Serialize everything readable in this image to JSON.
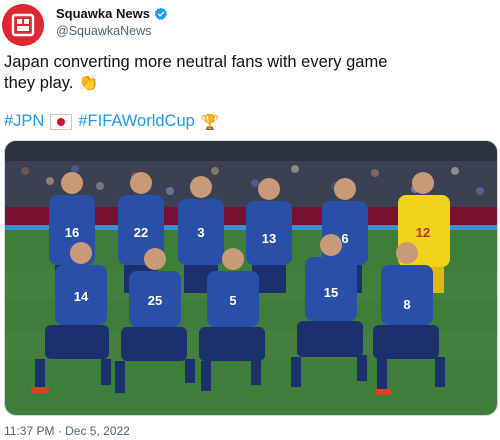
{
  "author": {
    "display_name": "Squawka News",
    "handle": "@SquawkaNews",
    "verified": true,
    "avatar_color": "#e0262f"
  },
  "tweet": {
    "text_line1": "Japan converting more neutral fans with every game",
    "text_line2": "they play. 👏",
    "hashtag1": "#JPN",
    "hashtag2": "#FIFAWorldCup",
    "timestamp": "11:37 PM · Dec 5, 2022"
  },
  "photo": {
    "jersey_numbers": [
      "16",
      "22",
      "3",
      "13",
      "6",
      "12",
      "14",
      "25",
      "5",
      "15",
      "8"
    ],
    "kit_color": "#2a4fa8",
    "keeper_color": "#f2d21a"
  },
  "colors": {
    "link": "#1d9bf0",
    "secondary_text": "#536471",
    "verified": "#1d9bf0"
  },
  "icons": [
    "verified-badge-icon",
    "japan-flag-icon",
    "trophy-icon",
    "clapping-hands-icon"
  ]
}
